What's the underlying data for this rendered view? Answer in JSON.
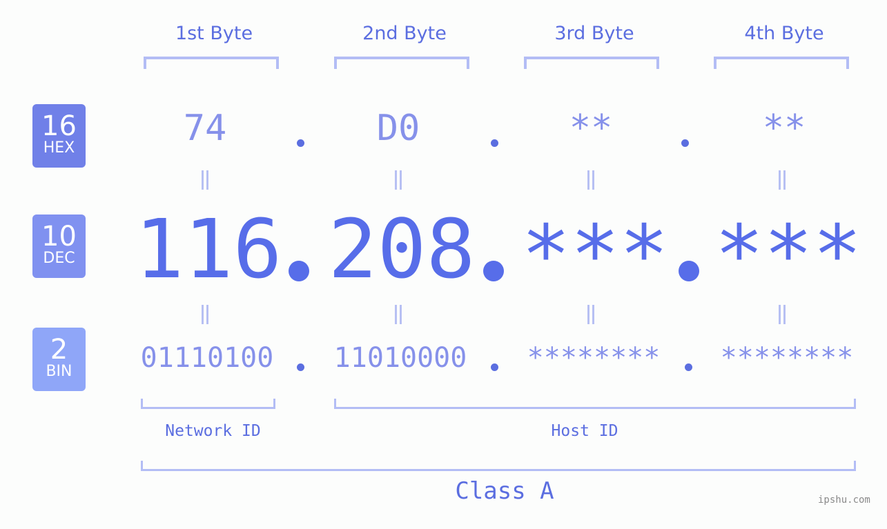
{
  "byte_headers": [
    "1st Byte",
    "2nd Byte",
    "3rd Byte",
    "4th Byte"
  ],
  "badges": {
    "hex": {
      "base": "16",
      "label": "HEX",
      "color": "#7080e8"
    },
    "dec": {
      "base": "10",
      "label": "DEC",
      "color": "#8091f0"
    },
    "bin": {
      "base": "2",
      "label": "BIN",
      "color": "#8fa6f8"
    }
  },
  "hex_values": [
    "74",
    "D0",
    "**",
    "**"
  ],
  "dec_values": [
    "116",
    "208",
    "***",
    "***"
  ],
  "bin_values": [
    "01110100",
    "11010000",
    "********",
    "********"
  ],
  "network_label": "Network ID",
  "host_label": "Host ID",
  "class_label": "Class A",
  "watermark": "ipshu.com",
  "colors": {
    "primary": "#576de9",
    "light": "#8691ea",
    "bracket": "#b3bdf5"
  }
}
